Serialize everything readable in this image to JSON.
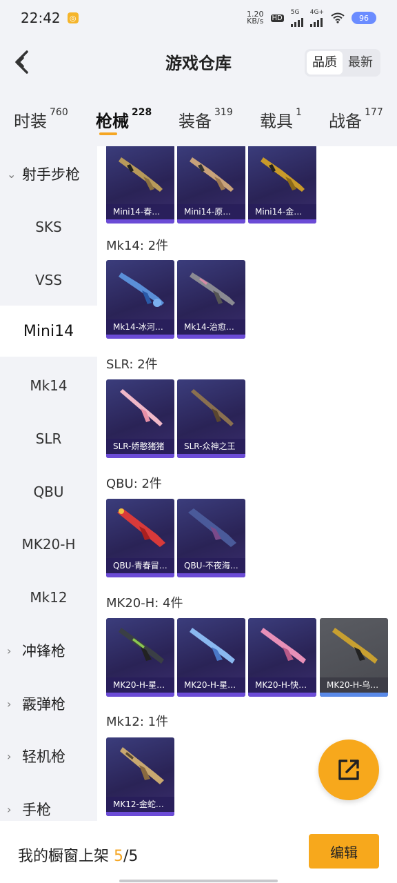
{
  "status": {
    "time": "22:42",
    "net_speed": "1.20",
    "net_unit": "KB/s",
    "hd": "HD",
    "net_5g": "5G",
    "net_4g": "4G+",
    "battery": "96"
  },
  "header": {
    "title": "游戏仓库",
    "sort_quality": "品质",
    "sort_newest": "最新"
  },
  "tabs": [
    {
      "label": "时装",
      "count": "760"
    },
    {
      "label": "枪械",
      "count": "228"
    },
    {
      "label": "装备",
      "count": "319"
    },
    {
      "label": "载具",
      "count": "1"
    },
    {
      "label": "战备",
      "count": "177"
    }
  ],
  "sidebar": {
    "items": [
      {
        "label": "射手步枪",
        "group": true,
        "chevron": "⌄"
      },
      {
        "label": "SKS"
      },
      {
        "label": "VSS"
      },
      {
        "label": "Mini14",
        "active": true
      },
      {
        "label": "Mk14"
      },
      {
        "label": "SLR"
      },
      {
        "label": "QBU"
      },
      {
        "label": "MK20-H"
      },
      {
        "label": "Mk12"
      },
      {
        "label": "冲锋枪",
        "group": true,
        "chevron": "›"
      },
      {
        "label": "霰弹枪",
        "group": true,
        "chevron": "›"
      },
      {
        "label": "轻机枪",
        "group": true,
        "chevron": "›"
      },
      {
        "label": "手枪",
        "group": true,
        "chevron": "›"
      }
    ]
  },
  "sections": [
    {
      "label": "",
      "items": [
        "Mini14-春…",
        "Mini14-原…",
        "Mini14-金…"
      ]
    },
    {
      "label": "Mk14: 2件",
      "items": [
        "Mk14-冰河…",
        "Mk14-治愈…"
      ]
    },
    {
      "label": "SLR: 2件",
      "items": [
        "SLR-娇憨猪猪",
        "SLR-众神之王"
      ]
    },
    {
      "label": "QBU: 2件",
      "items": [
        "QBU-青春冒…",
        "QBU-不夜海…"
      ]
    },
    {
      "label": "MK20-H: 4件",
      "items": [
        "MK20-H-星…",
        "MK20-H-星…",
        "MK20-H-快…",
        "MK20-H-乌…"
      ]
    },
    {
      "label": "Mk12: 1件",
      "items": [
        "MK12-金蛇…"
      ]
    }
  ],
  "bottom": {
    "prefix": "我的橱窗上架 ",
    "current": "5",
    "total": "/5",
    "edit_label": "编辑"
  },
  "colors": {
    "accent": "#f7a81c",
    "card_bg": "#2a2356",
    "card_footer": "#6b4bd6"
  }
}
